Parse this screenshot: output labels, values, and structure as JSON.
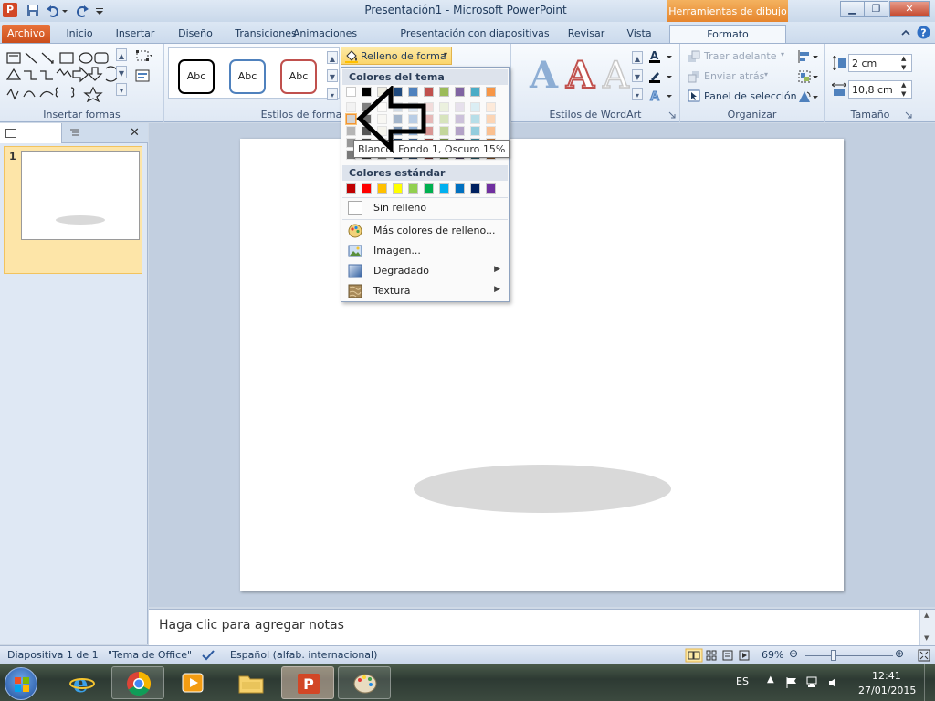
{
  "window": {
    "title": "Presentación1 - Microsoft PowerPoint",
    "context_header": "Herramientas de dibujo"
  },
  "tabs": [
    {
      "label": "Archivo"
    },
    {
      "label": "Inicio"
    },
    {
      "label": "Insertar"
    },
    {
      "label": "Diseño"
    },
    {
      "label": "Transiciones"
    },
    {
      "label": "Animaciones"
    },
    {
      "label": "Presentación con diapositivas"
    },
    {
      "label": "Revisar"
    },
    {
      "label": "Vista"
    },
    {
      "label": "Formato"
    }
  ],
  "ribbon": {
    "groups": {
      "insert_shapes": "Insertar formas",
      "shape_styles": "Estilos de forma",
      "wordart_styles": "Estilos de WordArt",
      "arrange": "Organizar",
      "size": "Tamaño"
    },
    "shape_style_samples": [
      "Abc",
      "Abc",
      "Abc"
    ],
    "shape_fill_button": "Relleno de forma",
    "arrange_items": {
      "bring_forward": "Traer adelante",
      "send_backward": "Enviar atrás",
      "selection_pane": "Panel de selección"
    },
    "size": {
      "height": "2 cm",
      "width": "10,8 cm"
    }
  },
  "dropdown": {
    "theme_colors_header": "Colores del tema",
    "standard_colors_header": "Colores estándar",
    "theme_top_row": [
      "#ffffff",
      "#000000",
      "#eeece1",
      "#1f497d",
      "#4f81bd",
      "#c0504d",
      "#9bbb59",
      "#8064a2",
      "#4bacc6",
      "#f79646"
    ],
    "standard_colors": [
      "#c00000",
      "#ff0000",
      "#ffc000",
      "#ffff00",
      "#92d050",
      "#00b050",
      "#00b0f0",
      "#0070c0",
      "#002060",
      "#7030a0"
    ],
    "items": {
      "no_fill": "Sin relleno",
      "more_colors": "Más colores de relleno...",
      "picture": "Imagen...",
      "gradient": "Degradado",
      "texture": "Textura"
    },
    "tooltip": "Blanco, Fondo 1, Oscuro 15%"
  },
  "slides_pane": {
    "slide_number": "1"
  },
  "notes": {
    "placeholder": "Haga clic para agregar notas"
  },
  "status": {
    "slide_info": "Diapositiva 1 de 1",
    "theme": "\"Tema de Office\"",
    "language": "Español (alfab. internacional)",
    "zoom": "69%"
  },
  "taskbar": {
    "lang": "ES",
    "time": "12:41",
    "date": "27/01/2015"
  }
}
